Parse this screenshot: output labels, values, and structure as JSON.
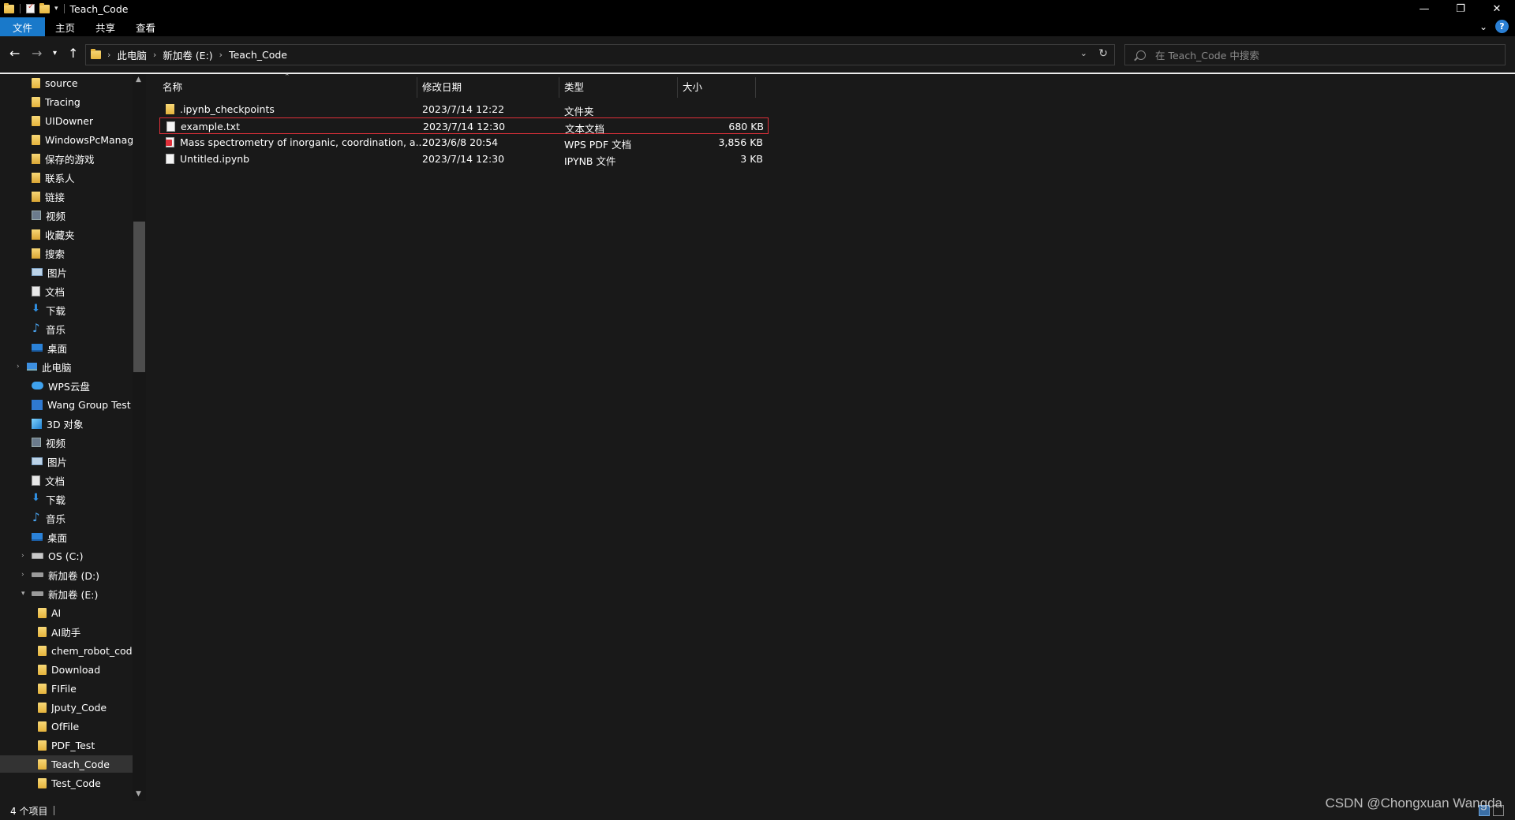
{
  "window": {
    "title": "Teach_Code"
  },
  "ribbon": {
    "tabs": [
      "文件",
      "主页",
      "共享",
      "查看"
    ]
  },
  "address": {
    "crumbs": [
      "此电脑",
      "新加卷 (E:)",
      "Teach_Code"
    ]
  },
  "search": {
    "placeholder": "在 Teach_Code 中搜索"
  },
  "sidebar": {
    "items": [
      {
        "label": "source",
        "icon": "folder-icon"
      },
      {
        "label": "Tracing",
        "icon": "folder-icon"
      },
      {
        "label": "UIDowner",
        "icon": "folder-icon"
      },
      {
        "label": "WindowsPcManag",
        "icon": "folder-icon"
      },
      {
        "label": "保存的游戏",
        "icon": "saved-games-icon"
      },
      {
        "label": "联系人",
        "icon": "contacts-icon"
      },
      {
        "label": "链接",
        "icon": "links-icon"
      },
      {
        "label": "视频",
        "icon": "video-icon"
      },
      {
        "label": "收藏夹",
        "icon": "favorites-icon"
      },
      {
        "label": "搜索",
        "icon": "searches-icon"
      },
      {
        "label": "图片",
        "icon": "pictures-icon"
      },
      {
        "label": "文档",
        "icon": "documents-icon"
      },
      {
        "label": "下载",
        "icon": "downloads-icon"
      },
      {
        "label": "音乐",
        "icon": "music-icon"
      },
      {
        "label": "桌面",
        "icon": "desktop-icon"
      },
      {
        "label": "此电脑",
        "icon": "this-pc-icon"
      },
      {
        "label": "WPS云盘",
        "icon": "cloud-icon"
      },
      {
        "label": "Wang Group Test",
        "icon": "group-icon"
      },
      {
        "label": "3D 对象",
        "icon": "3d-objects-icon"
      },
      {
        "label": "视频",
        "icon": "video-icon"
      },
      {
        "label": "图片",
        "icon": "pictures-icon"
      },
      {
        "label": "文档",
        "icon": "documents-icon"
      },
      {
        "label": "下载",
        "icon": "downloads-icon"
      },
      {
        "label": "音乐",
        "icon": "music-icon"
      },
      {
        "label": "桌面",
        "icon": "desktop-icon"
      },
      {
        "label": "OS (C:)",
        "icon": "drive-icon"
      },
      {
        "label": "新加卷 (D:)",
        "icon": "drive-icon"
      },
      {
        "label": "新加卷 (E:)",
        "icon": "drive-icon"
      },
      {
        "label": "AI",
        "icon": "folder-icon"
      },
      {
        "label": "AI助手",
        "icon": "folder-icon"
      },
      {
        "label": "chem_robot_code",
        "icon": "folder-icon"
      },
      {
        "label": "Download",
        "icon": "folder-icon"
      },
      {
        "label": "FIFile",
        "icon": "folder-icon"
      },
      {
        "label": "Jputy_Code",
        "icon": "folder-icon"
      },
      {
        "label": "OfFile",
        "icon": "folder-icon"
      },
      {
        "label": "PDF_Test",
        "icon": "folder-icon"
      },
      {
        "label": "Teach_Code",
        "icon": "folder-icon",
        "selected": true
      },
      {
        "label": "Test_Code",
        "icon": "folder-icon"
      }
    ]
  },
  "columns": {
    "name": "名称",
    "date": "修改日期",
    "type": "类型",
    "size": "大小"
  },
  "files": [
    {
      "name": ".ipynb_checkpoints",
      "date": "2023/7/14 12:22",
      "type": "文件夹",
      "size": "",
      "icon": "folder-icon"
    },
    {
      "name": "example.txt",
      "date": "2023/7/14 12:30",
      "type": "文本文档",
      "size": "680 KB",
      "icon": "text-file-icon",
      "highlighted": true
    },
    {
      "name": "Mass spectrometry of inorganic, coordination, a...",
      "date": "2023/6/8 20:54",
      "type": "WPS PDF 文档",
      "size": "3,856 KB",
      "icon": "pdf-file-icon"
    },
    {
      "name": "Untitled.ipynb",
      "date": "2023/7/14 12:30",
      "type": "IPYNB 文件",
      "size": "3 KB",
      "icon": "ipynb-file-icon"
    }
  ],
  "status": {
    "count": "4 个项目"
  },
  "watermark": "CSDN @Chongxuan Wangda"
}
